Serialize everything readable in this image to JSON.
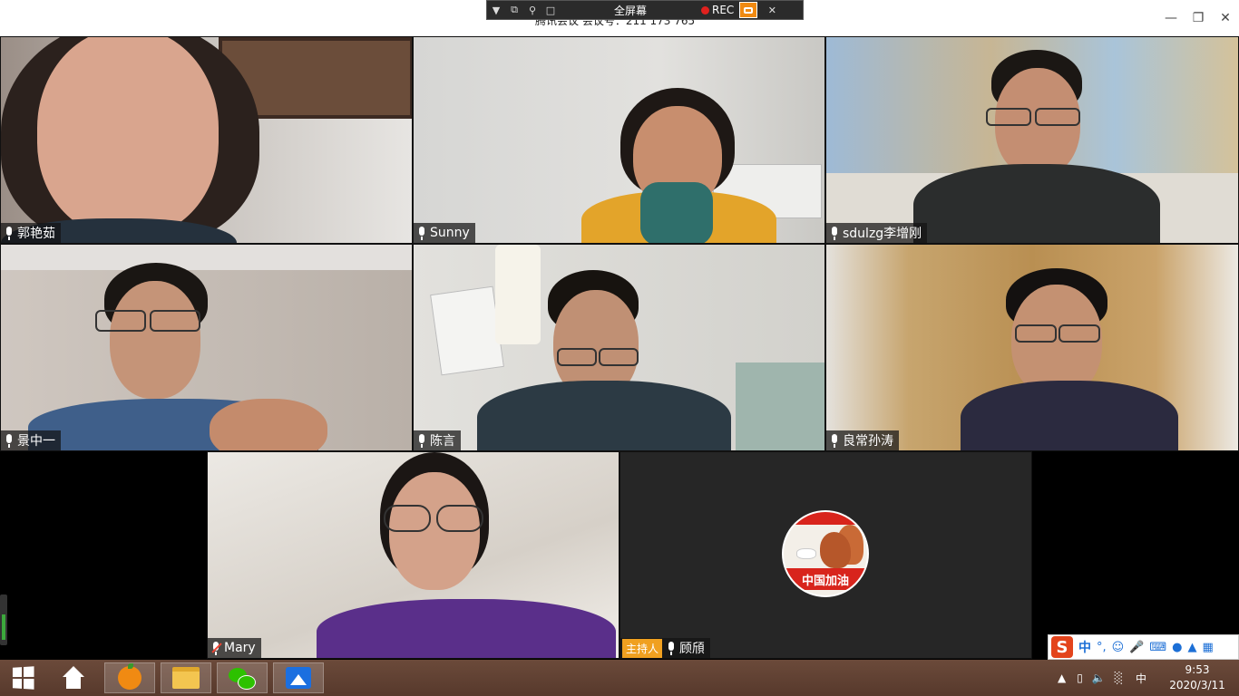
{
  "titlebar": {
    "title": "腾讯会议  会议号：211 173 765",
    "minimize_icon": "minimize-icon",
    "restore_icon": "restore-icon",
    "close_icon": "close-icon"
  },
  "record_bar": {
    "fullscreen_label": "全屏幕",
    "rec_label": "REC"
  },
  "participants": [
    {
      "name": "郭艳茹",
      "mic": "on"
    },
    {
      "name": "Sunny",
      "mic": "on"
    },
    {
      "name": "sdulzg李增刚",
      "mic": "on"
    },
    {
      "name": "景中一",
      "mic": "on"
    },
    {
      "name": "陈言",
      "mic": "on"
    },
    {
      "name": "良常孙涛",
      "mic": "on"
    },
    {
      "name": "Mary",
      "mic": "muted"
    },
    {
      "name": "顾頎",
      "mic": "on",
      "host_badge": "主持人",
      "avatar_text": "中国加油"
    }
  ],
  "ime": {
    "logo": "S",
    "lang": "中",
    "punct": "°,"
  },
  "taskbar": {
    "tray_lang": "中",
    "time": "9:53",
    "date": "2020/3/11"
  },
  "colors": {
    "taskbar_bg": "#5f4133",
    "host_badge": "#f0a020",
    "rec_dot": "#e0211e",
    "meeting_app": "#1b6fe0"
  }
}
